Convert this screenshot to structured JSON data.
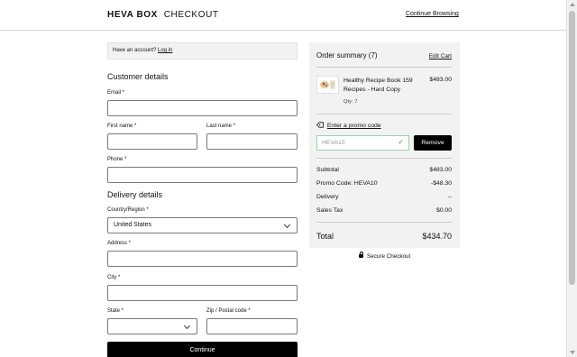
{
  "header": {
    "brand_bold": "HEVA BOX",
    "brand_light": "CHECKOUT",
    "continue_browsing": "Continue Browsing"
  },
  "login": {
    "prompt": "Have an account?",
    "link": "Log in"
  },
  "customer": {
    "title": "Customer details",
    "email_label": "Email *",
    "first_name_label": "First name *",
    "last_name_label": "Last name *",
    "phone_label": "Phone *"
  },
  "delivery": {
    "title": "Delivery details",
    "country_label": "Country/Region *",
    "country_value": "United States",
    "address_label": "Address *",
    "city_label": "City *",
    "state_label": "State *",
    "zip_label": "Zip / Postal code *"
  },
  "continue_button": "Continue",
  "summary": {
    "title": "Order summary (7)",
    "edit_cart": "Edit Cart",
    "item": {
      "name": "Healthy Recipe Book 159 Recipes - Hard Copy",
      "price": "$483.00",
      "qty": "Qty: 7"
    },
    "promo_link": "Enter a promo code",
    "promo_value": "HEVA10",
    "remove_button": "Remove",
    "rows": {
      "subtotal_label": "Subtotal",
      "subtotal_value": "$483.00",
      "promo_label": "Promo Code: HEVA10",
      "promo_value": "-$48.30",
      "delivery_label": "Delivery",
      "delivery_value": "--",
      "tax_label": "Sales Tax",
      "tax_value": "$0.00"
    },
    "total_label": "Total",
    "total_value": "$434.70"
  },
  "secure_checkout": "Secure Checkout",
  "colors": {
    "accent": "#000000",
    "panel_bg": "#f2f2f2",
    "promo_success": "#3a9a52"
  }
}
